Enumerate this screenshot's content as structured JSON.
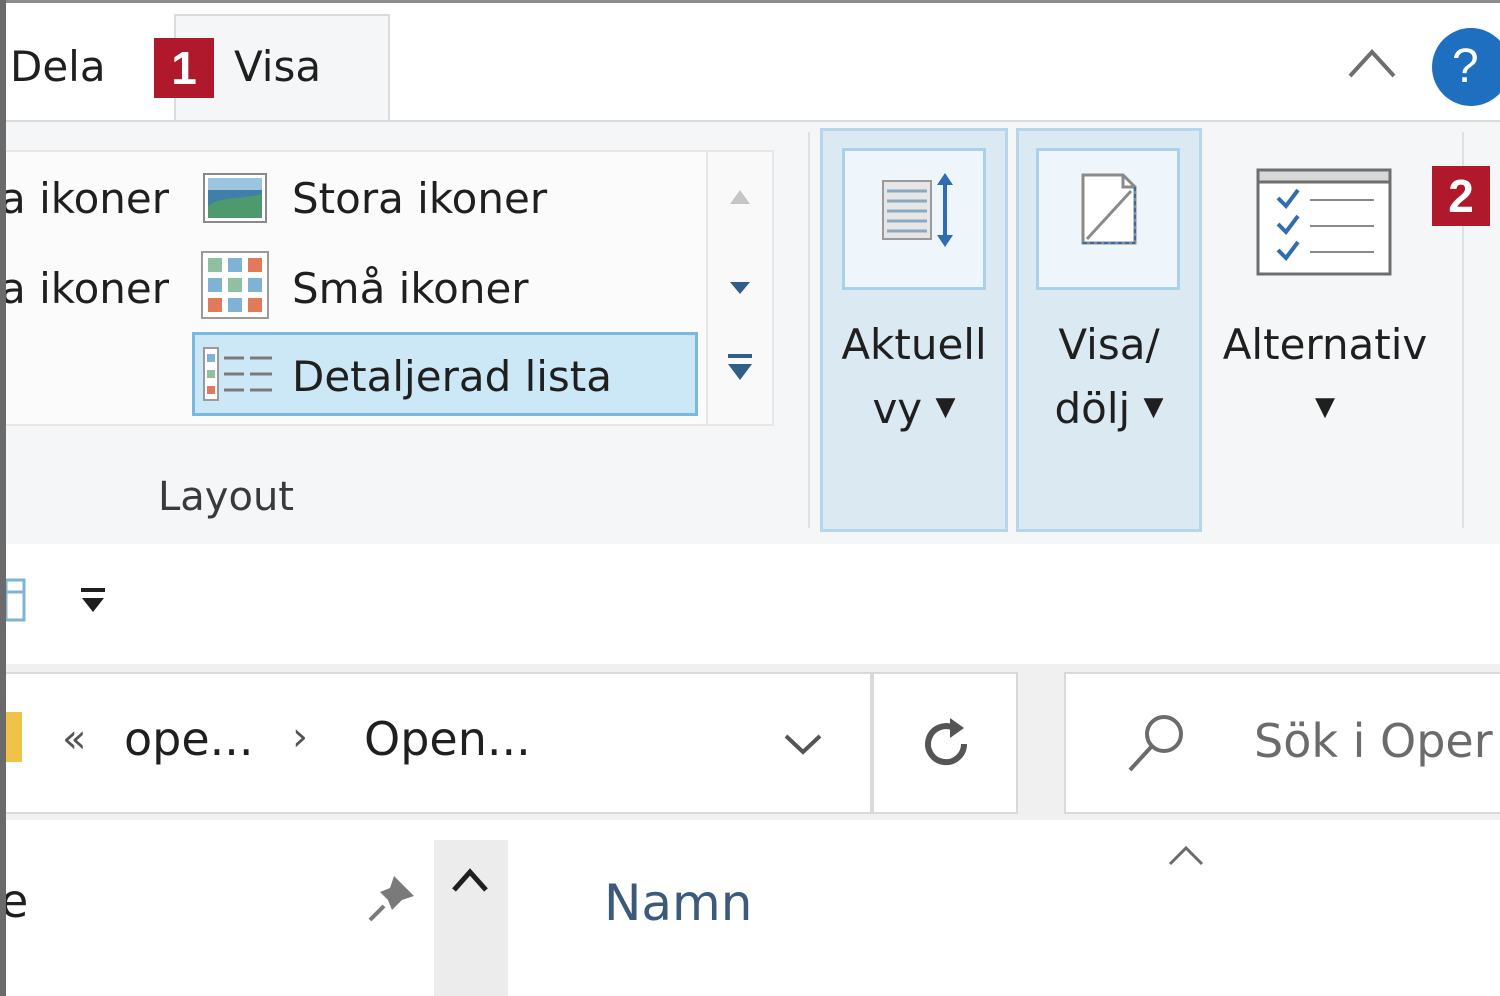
{
  "tabs": {
    "dela": "Dela",
    "visa": "Visa",
    "badge_1": "1",
    "badge_2": "2"
  },
  "help": {
    "label": "?"
  },
  "layout_group": {
    "items_partial_left": [
      "a ikoner",
      "a ikoner"
    ],
    "stora": "Stora ikoner",
    "sma": "Små ikoner",
    "detaljerad": "Detaljerad lista",
    "selected": "Detaljerad lista",
    "label": "Layout"
  },
  "buttons": {
    "aktuell_vy_line1": "Aktuell",
    "aktuell_vy_line2": "vy",
    "visa_dolj_line1": "Visa/",
    "visa_dolj_line2": "dölj",
    "alternativ": "Alternativ"
  },
  "address_bar": {
    "back_glyph": "«",
    "crumb_1": "ope...",
    "separator": "›",
    "crumb_2": "Open...",
    "search_placeholder": "Sök i Oper"
  },
  "file_list": {
    "left_cut": "e",
    "column_name": "Namn"
  },
  "colors": {
    "badge": "#b0182b",
    "help_button": "#1e6fc0",
    "selection_fill": "#cce8f6",
    "selection_border": "#79b8e0"
  },
  "icons": {
    "stora": "large-icons-icon",
    "sma": "small-icons-icon",
    "detaljerad": "details-icon",
    "aktuell": "current-view-icon",
    "visa_dolj": "show-hide-icon",
    "alternativ": "options-icon"
  }
}
